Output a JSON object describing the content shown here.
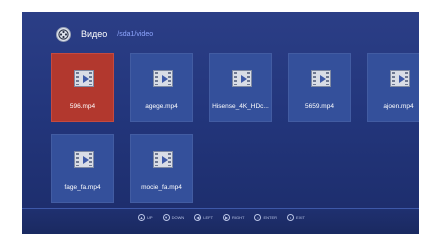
{
  "header": {
    "logo_icon": "film-reel-icon",
    "title": "Видео",
    "path": "/sda1/video"
  },
  "files": [
    {
      "name": "596.mp4",
      "selected": true
    },
    {
      "name": "agege.mp4",
      "selected": false
    },
    {
      "name": "Hisense_4K_HDc...",
      "selected": false
    },
    {
      "name": "5659.mp4",
      "selected": false
    },
    {
      "name": "ajoen.mp4",
      "selected": false
    },
    {
      "name": "fage_fa.mp4",
      "selected": false
    },
    {
      "name": "mocie_fa.mp4",
      "selected": false
    }
  ],
  "footer": {
    "hints": [
      {
        "icon": "up-arrow-icon",
        "label": "UP"
      },
      {
        "icon": "down-arrow-icon",
        "label": "DOWN"
      },
      {
        "icon": "left-arrow-icon",
        "label": "LEFT"
      },
      {
        "icon": "right-arrow-icon",
        "label": "RIGHT"
      },
      {
        "icon": "enter-key-icon",
        "label": "ENTER"
      },
      {
        "icon": "exit-key-icon",
        "label": "EXIT"
      }
    ]
  },
  "colors": {
    "background": "#23367c",
    "tile": "#34509b",
    "tile_selected": "#b2382e",
    "path_text": "#8ea6ff"
  }
}
